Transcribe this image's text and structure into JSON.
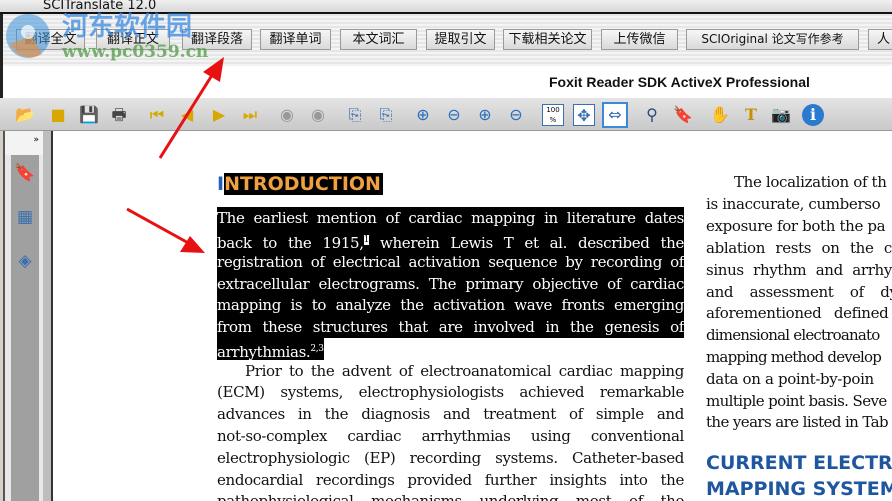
{
  "window": {
    "title": "SCITranslate 12.0"
  },
  "buttons": [
    "翻译全文",
    "翻译正文",
    "翻译段落",
    "翻译单词",
    "本文词汇",
    "提取引文",
    "下载相关论文",
    "上传微信",
    "SCIOriginal 论文写作参考",
    "人"
  ],
  "foxit_label": "Foxit Reader SDK ActiveX Professional",
  "watermark": {
    "name": "河东软件园",
    "url": "www.pc0359.cn"
  },
  "toolbar_icons": [
    "open-folder-icon",
    "open-file-icon",
    "save-icon",
    "print-icon",
    "first-page-icon",
    "previous-page-icon",
    "next-page-icon",
    "last-page-icon",
    "back-icon",
    "forward-icon",
    "rotate-right-icon",
    "rotate-left-icon",
    "zoom-in-icon",
    "zoom-out-icon",
    "zoom-plus-icon",
    "zoom-minus-icon",
    "actual-size-icon",
    "fit-page-icon",
    "fit-width-icon",
    "find-icon",
    "bookmark-icon",
    "hand-tool-icon",
    "text-select-icon",
    "snapshot-icon",
    "info-icon"
  ],
  "toolbar_actual_size": "100 %",
  "sidebar": {
    "expand": "»",
    "icons": [
      "bookmarks-icon",
      "thumbnails-icon",
      "layers-icon"
    ]
  },
  "document": {
    "heading_first": "I",
    "heading_rest": "NTRODUCTION",
    "highlighted_lines": [
      "The earliest mention of cardiac mapping in literature dates",
      "back to the 1915,",
      "registration of electrical activation sequence by recording of",
      "extracellular electrograms. The primary objective of cardiac",
      "mapping is to analyze the activation wave fronts emerging",
      "from these structures that are involved in the genesis of",
      "arrhythmias."
    ],
    "line2_sup": "1",
    "line2_rest": " wherein Lewis T et al. described the",
    "last_sup": "2,3",
    "lines": [
      "Prior to the advent of electroanatomical cardiac mapping",
      "(ECM) systems, electrophysiologists achieved remarkable",
      "advances in the diagnosis and treatment of simple and",
      "not-so-complex cardiac arrhythmias using conventional",
      "electrophysiologic (EP) recording systems. Catheter-based",
      "endocardial recordings provided further insights into the",
      "pathophysiological mechanisms underlying most of the"
    ],
    "right_lines": [
      "The localization of th",
      "is inaccurate, cumberso",
      "exposure for both the pa",
      "ablation rests on the c",
      "sinus rhythm and arrhy",
      "and assessment of dy",
      "aforementioned defined",
      "dimensional electroanato",
      "mapping method develop",
      "data on a point-by-poin",
      "multiple point basis. Seve",
      "the years are listed in Tab"
    ],
    "right_heading": [
      "CURRENT ELECTRO",
      "MAPPING SYSTEM"
    ]
  },
  "colors": {
    "highlight": "#000000",
    "heading_orange": "#f0a040",
    "heading_blue": "#1e56a0",
    "arrow": "#e81010"
  }
}
